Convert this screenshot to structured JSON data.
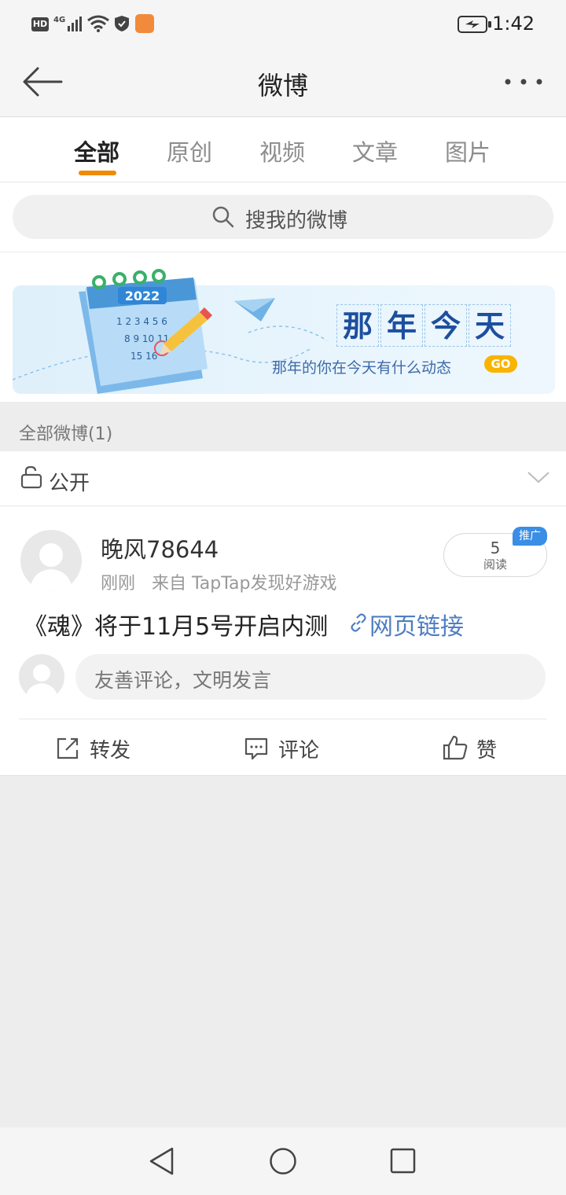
{
  "status_bar": {
    "icons": [
      "hd-icon",
      "4g-signal-icon",
      "wifi-icon",
      "shield-icon",
      "app-notification-icon"
    ],
    "battery_icon": "battery-charging-icon",
    "time": "1:42"
  },
  "header": {
    "back_icon": "back-arrow-icon",
    "title": "微博",
    "more_icon": "more-dots-icon"
  },
  "tabs": [
    {
      "label": "全部",
      "active": true
    },
    {
      "label": "原创",
      "active": false
    },
    {
      "label": "视频",
      "active": false
    },
    {
      "label": "文章",
      "active": false
    },
    {
      "label": "图片",
      "active": false
    }
  ],
  "search": {
    "placeholder": "搜我的微博",
    "icon": "search-icon"
  },
  "banner": {
    "calendar_year": "2022",
    "title_chars": [
      "那",
      "年",
      "今",
      "天"
    ],
    "subtitle": "那年的你在今天有什么动态",
    "go_label": "GO"
  },
  "section": {
    "label": "全部微博(1)"
  },
  "visibility": {
    "label": "公开",
    "icon": "unlock-icon",
    "chevron": "chevron-down-icon"
  },
  "post": {
    "username": "晚风78644",
    "time": "刚刚",
    "source": "来自 TapTap发现好游戏",
    "reads_count": "5",
    "reads_label": "阅读",
    "promo_badge": "推广",
    "text": "《魂》将于11月5号开启内测",
    "link_text": "网页链接",
    "link_icon": "link-icon",
    "comment_placeholder": "友善评论，文明发言",
    "actions": [
      {
        "label": "转发",
        "icon": "repost-icon"
      },
      {
        "label": "评论",
        "icon": "comment-icon"
      },
      {
        "label": "赞",
        "icon": "like-icon"
      }
    ]
  },
  "nav_bar": {
    "back": "nav-back-icon",
    "home": "nav-home-icon",
    "recents": "nav-recents-icon"
  },
  "colors": {
    "accent": "#f08a00",
    "link": "#4f7ec3",
    "banner_title": "#1d4f9e"
  }
}
